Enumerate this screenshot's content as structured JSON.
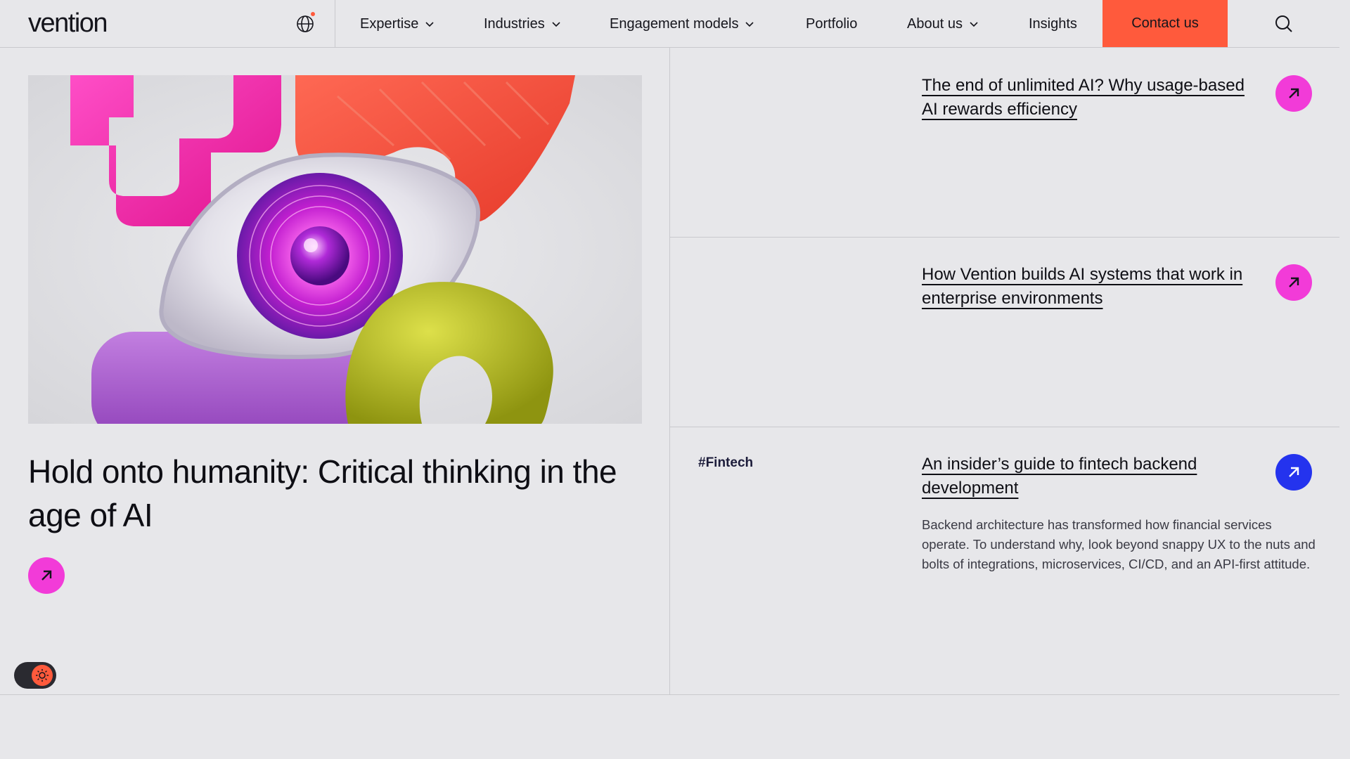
{
  "brand": {
    "logo_text": "vention",
    "accent_color": "#ff5a3c"
  },
  "header": {
    "language_icon": "globe-icon",
    "nav": [
      {
        "label": "Expertise",
        "has_dropdown": true
      },
      {
        "label": "Industries",
        "has_dropdown": true
      },
      {
        "label": "Engagement models",
        "has_dropdown": true
      },
      {
        "label": "Portfolio",
        "has_dropdown": false
      },
      {
        "label": "About us",
        "has_dropdown": true
      },
      {
        "label": "Insights",
        "has_dropdown": false
      }
    ],
    "contact_label": "Contact us",
    "search_icon": "search-icon"
  },
  "featured": {
    "title": "Hold onto humanity: Critical thinking in the age of AI",
    "arrow_color": "#f23bd8"
  },
  "articles": [
    {
      "tag": "",
      "title": "The end of unlimited AI? Why usage-based AI rewards efficiency",
      "arrow_color": "#f23bd8",
      "excerpt": ""
    },
    {
      "tag": "",
      "title": "How Vention builds AI systems that work in enterprise environments",
      "arrow_color": "#f23bd8",
      "excerpt": ""
    },
    {
      "tag": "#Fintech",
      "title": "An insider’s guide to fintech backend development",
      "arrow_color": "#2433ee",
      "excerpt": "Backend architecture has transformed how financial services operate. To understand why, look beyond snappy UX to the nuts and bolts of integrations, microservices, CI/CD, and an API-first attitude."
    }
  ],
  "theme_toggle": {
    "icon": "sun-icon",
    "mode": "light"
  }
}
